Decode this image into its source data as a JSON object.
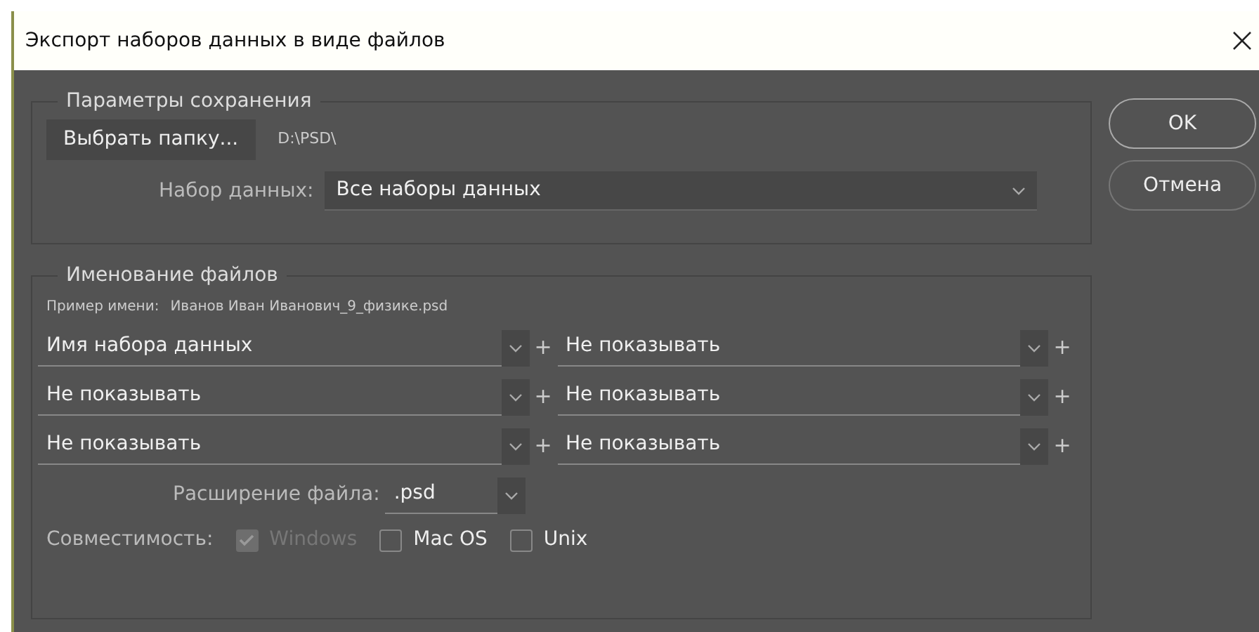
{
  "window": {
    "title": "Экспорт наборов данных в виде файлов"
  },
  "save_options": {
    "legend": "Параметры сохранения",
    "choose_folder_button": "Выбрать папку...",
    "folder_path": "D:\\PSD\\",
    "dataset_label": "Набор данных:",
    "dataset_value": "Все наборы данных"
  },
  "file_naming": {
    "legend": "Именование файлов",
    "example_label": "Пример имени:",
    "example_value": "Иванов Иван Иванович_9_физике.psd",
    "rows": [
      {
        "fields": [
          "Имя набора данных",
          "Не показывать"
        ],
        "plus": [
          "+",
          "+"
        ]
      },
      {
        "fields": [
          "Не показывать",
          "Не показывать"
        ],
        "plus": [
          "+",
          "+"
        ]
      },
      {
        "fields": [
          "Не показывать",
          "Не показывать"
        ],
        "plus": [
          "+",
          "+"
        ]
      }
    ],
    "extension_label": "Расширение файла:",
    "extension_value": ".psd",
    "compatibility_label": "Совместимость:",
    "compatibility": [
      {
        "label": "Windows",
        "checked": true,
        "disabled": true
      },
      {
        "label": "Mac OS",
        "checked": false,
        "disabled": false
      },
      {
        "label": "Unix",
        "checked": false,
        "disabled": false
      }
    ]
  },
  "buttons": [
    "OK",
    "Отмена"
  ]
}
